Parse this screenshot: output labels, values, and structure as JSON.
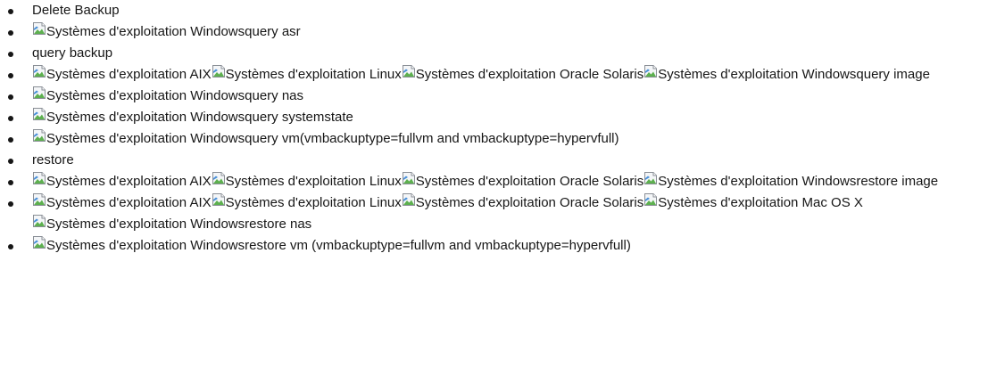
{
  "list": [
    {
      "parts": [
        {
          "type": "text",
          "text": "Delete Backup"
        }
      ]
    },
    {
      "parts": [
        {
          "type": "img",
          "alt": "Systèmes d'exploitation Windows"
        },
        {
          "type": "text",
          "text": "query asr"
        }
      ]
    },
    {
      "parts": [
        {
          "type": "text",
          "text": "query backup"
        }
      ]
    },
    {
      "parts": [
        {
          "type": "img",
          "alt": "Systèmes d'exploitation AIX"
        },
        {
          "type": "img",
          "alt": "Systèmes d'exploitation Linux"
        },
        {
          "type": "img",
          "alt": "Systèmes d'exploitation Oracle Solaris"
        },
        {
          "type": "img",
          "alt": "Systèmes d'exploitation Windows"
        },
        {
          "type": "text",
          "text": "query image"
        }
      ]
    },
    {
      "parts": [
        {
          "type": "img",
          "alt": "Systèmes d'exploitation Windows"
        },
        {
          "type": "text",
          "text": "query nas"
        }
      ]
    },
    {
      "parts": [
        {
          "type": "img",
          "alt": "Systèmes d'exploitation Windows"
        },
        {
          "type": "text",
          "text": "query systemstate"
        }
      ]
    },
    {
      "parts": [
        {
          "type": "img",
          "alt": "Systèmes d'exploitation Windows"
        },
        {
          "type": "text",
          "text": "query vm(vmbackuptype=fullvm and vmbackuptype=hypervfull)"
        }
      ]
    },
    {
      "parts": [
        {
          "type": "text",
          "text": "restore"
        }
      ]
    },
    {
      "parts": [
        {
          "type": "img",
          "alt": "Systèmes d'exploitation AIX"
        },
        {
          "type": "img",
          "alt": "Systèmes d'exploitation Linux"
        },
        {
          "type": "img",
          "alt": "Systèmes d'exploitation Oracle Solaris"
        },
        {
          "type": "img",
          "alt": "Systèmes d'exploitation Windows"
        },
        {
          "type": "text",
          "text": "restore image"
        }
      ]
    },
    {
      "parts": [
        {
          "type": "img",
          "alt": "Systèmes d'exploitation AIX"
        },
        {
          "type": "img",
          "alt": "Systèmes d'exploitation Linux"
        },
        {
          "type": "img",
          "alt": "Systèmes d'exploitation Oracle Solaris"
        },
        {
          "type": "img",
          "alt": "Systèmes d'exploitation Mac OS X"
        },
        {
          "type": "img",
          "alt": "Systèmes d'exploitation Windows"
        },
        {
          "type": "text",
          "text": "restore nas"
        }
      ]
    },
    {
      "parts": [
        {
          "type": "img",
          "alt": "Systèmes d'exploitation Windows"
        },
        {
          "type": "text",
          "text": "restore vm (vmbackuptype=fullvm and vmbackuptype=hypervfull)"
        }
      ]
    }
  ]
}
